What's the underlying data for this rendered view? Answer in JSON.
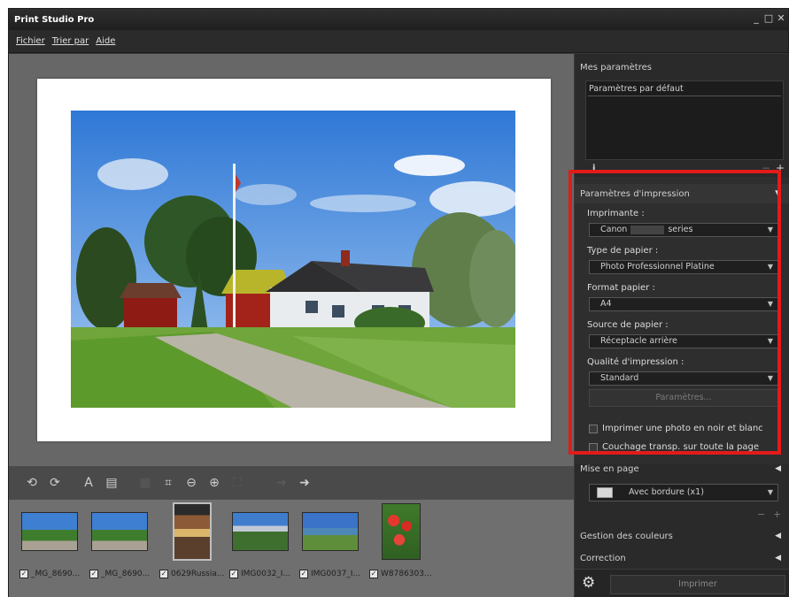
{
  "window": {
    "title": "Print Studio Pro"
  },
  "menu": [
    {
      "label": "Fichier"
    },
    {
      "label": "Trier par"
    },
    {
      "label": "Aide"
    }
  ],
  "my_settings": {
    "header": "Mes paramètres",
    "items": [
      "Paramètres par défaut"
    ]
  },
  "print_settings": {
    "header": "Paramètres d'impression",
    "printer_label": "Imprimante :",
    "printer_value_prefix": "Canon",
    "printer_value_suffix": "series",
    "paper_type_label": "Type de papier :",
    "paper_type_value": "Photo Professionnel Platine",
    "paper_size_label": "Format papier :",
    "paper_size_value": "A4",
    "paper_source_label": "Source de papier :",
    "paper_source_value": "Réceptacle arrière",
    "quality_label": "Qualité d'impression :",
    "quality_value": "Standard",
    "params_button": "Paramètres...",
    "bw_checkbox": "Imprimer une photo en noir et blanc",
    "coating_checkbox": "Couchage transp. sur toute la page"
  },
  "layout": {
    "header": "Mise en page",
    "value": "Avec bordure (x1)"
  },
  "color_management": {
    "header": "Gestion des couleurs"
  },
  "correction": {
    "header": "Correction"
  },
  "print_button": "Imprimer",
  "thumbnails": [
    {
      "caption": "_MG_8690..."
    },
    {
      "caption": "_MG_8690..."
    },
    {
      "caption": "0629Russia..."
    },
    {
      "caption": "IMG0032_I..."
    },
    {
      "caption": "IMG0037_I..."
    },
    {
      "caption": "W8786303..."
    }
  ],
  "colors": {
    "highlight_frame": "#e21b1b",
    "panel_bg": "#2a2a2a",
    "preview_bg": "#676767"
  }
}
